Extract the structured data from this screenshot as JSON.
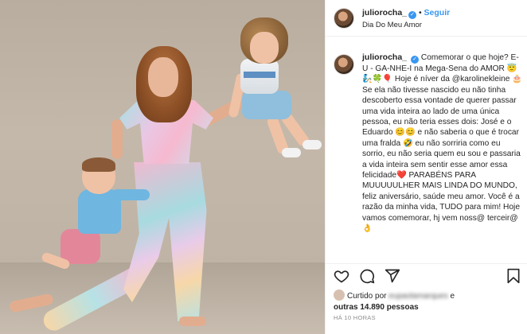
{
  "post": {
    "username": "juliorocha_",
    "follow_label": "Seguir",
    "location": "Dia Do Meu Amor",
    "caption": "Comemorar o que hoje? E-U - GA-NHE-I na Mega-Sena do AMOR 😇🧞🍀🎈 Hoje é níver da @karolinekleine 🎂 Se ela não tivesse nascido eu não tinha descoberto essa vontade de querer passar uma vida inteira ao lado de uma única pessoa, eu não teria esses dois: José e o Eduardo 😊😊 e não saberia o que é trocar uma fralda 🤣 eu não sorriria como eu sorrio, eu não seria quem eu sou e passaria a vida inteira sem sentir esse amor essa felicidade❤️ PARABÉNS PARA MUUUUULHER MAIS LINDA DO MUNDO, feliz aniversário, saúde meu amor. Você é a razão da minha vida, TUDO para mim! Hoje vamos comemorar, hj vem noss@ terceir@ 👌",
    "likes_prefix": "Curtido por",
    "liked_by": "eupaolamarques",
    "likes_conj": "e",
    "likes_rest": "outras 14.890 pessoas",
    "time": "HÁ 10 HORAS"
  },
  "icons": {
    "like": "heart-icon",
    "comment": "comment-icon",
    "share": "paper-plane-icon",
    "save": "bookmark-icon",
    "verified": "verified-badge-icon"
  },
  "colors": {
    "accent": "#3897f0",
    "text": "#262626",
    "muted": "#8e8e8e"
  }
}
